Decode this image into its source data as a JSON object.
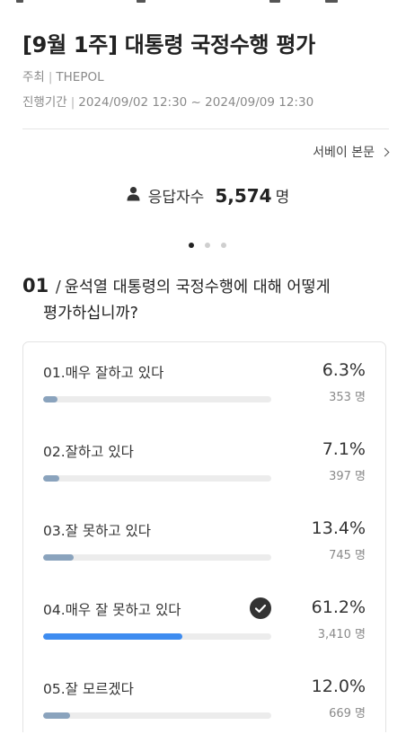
{
  "poll": {
    "title": "[9월 1주] 대통령 국정수행 평가",
    "host_label": "주최",
    "host_value": "THEPOL",
    "period_label": "진행기간",
    "period_value": "2024/09/02 12:30 ~ 2024/09/09 12:30",
    "survey_link_label": "서베이 본문"
  },
  "respondents": {
    "label": "응답자수",
    "count": "5,574",
    "unit": "명"
  },
  "pagination": {
    "total": 3,
    "active_index": 0
  },
  "question": {
    "number": "01",
    "separator": "/",
    "text_line1": "윤석열 대통령의 국정수행에 대해 어떻게",
    "text_line2": "평가하십니까?"
  },
  "options": [
    {
      "label": "01.매우 잘하고 있다",
      "percent": "6.3%",
      "count": "353 명",
      "value": 6.3,
      "selected": false
    },
    {
      "label": "02.잘하고 있다",
      "percent": "7.1%",
      "count": "397 명",
      "value": 7.1,
      "selected": false
    },
    {
      "label": "03.잘 못하고 있다",
      "percent": "13.4%",
      "count": "745 명",
      "value": 13.4,
      "selected": false
    },
    {
      "label": "04.매우 잘 못하고 있다",
      "percent": "61.2%",
      "count": "3,410 명",
      "value": 61.2,
      "selected": true
    },
    {
      "label": "05.잘 모르겠다",
      "percent": "12.0%",
      "count": "669 명",
      "value": 12.0,
      "selected": false
    }
  ],
  "colors": {
    "bar_default": "#8aa3bd",
    "bar_selected": "#3e8cf0",
    "bar_track": "#ececec",
    "check_bg": "#333333"
  },
  "icons": {
    "respondents": "person-icon",
    "survey_link": "chevron-right-icon",
    "selected": "check-circle-icon"
  }
}
